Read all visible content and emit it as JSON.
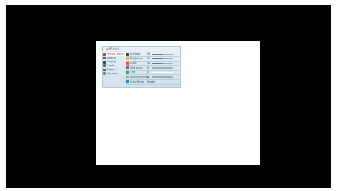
{
  "osd": {
    "title": "MENU",
    "menu_items": [
      {
        "label": "Picture Adjust",
        "icon": "picture-icon",
        "color": "#c0392b",
        "active": true
      },
      {
        "label": "Setting",
        "icon": "setting-icon",
        "color": "#3a6ea5",
        "active": false
      },
      {
        "label": "Display",
        "icon": "display-icon",
        "color": "#2c3e50",
        "active": false
      },
      {
        "label": "Config",
        "icon": "config-icon",
        "color": "#5d6d7e",
        "active": false
      },
      {
        "label": "Trigger 1",
        "icon": "trigger-icon",
        "color": "#1e8449",
        "active": false
      },
      {
        "label": "Memory",
        "icon": "memory-icon",
        "color": "#7f8c8d",
        "active": false
      }
    ],
    "settings": [
      {
        "label": "Contrast",
        "value": "50",
        "level": 0.5,
        "icon": "contrast-icon",
        "color": "#34495e",
        "kind": "slider"
      },
      {
        "label": "Brightness",
        "value": "50",
        "level": 0.5,
        "icon": "brightness-icon",
        "color": "#f5b041",
        "kind": "slider"
      },
      {
        "label": "Color",
        "value": "50",
        "level": 0.5,
        "icon": "color-icon",
        "color": "#e74c3c",
        "kind": "slider"
      },
      {
        "label": "Sharpness",
        "value": "0",
        "level": 0.0,
        "icon": "sharpness-icon",
        "color": "#8e44ad",
        "kind": "slider"
      },
      {
        "label": "Tint",
        "value": "0",
        "level": 0.0,
        "icon": "tint-icon",
        "color": "#27ae60",
        "kind": "slider",
        "highlight": true
      },
      {
        "label": "Noise Reduction",
        "value": "0",
        "level": 0.0,
        "icon": "noise-reduction-icon",
        "color": "#95a5a6",
        "kind": "slider"
      },
      {
        "label": "Color Temp.",
        "value": "Middle",
        "icon": "color-temp-icon",
        "color": "#2e86c1",
        "kind": "text"
      }
    ]
  }
}
